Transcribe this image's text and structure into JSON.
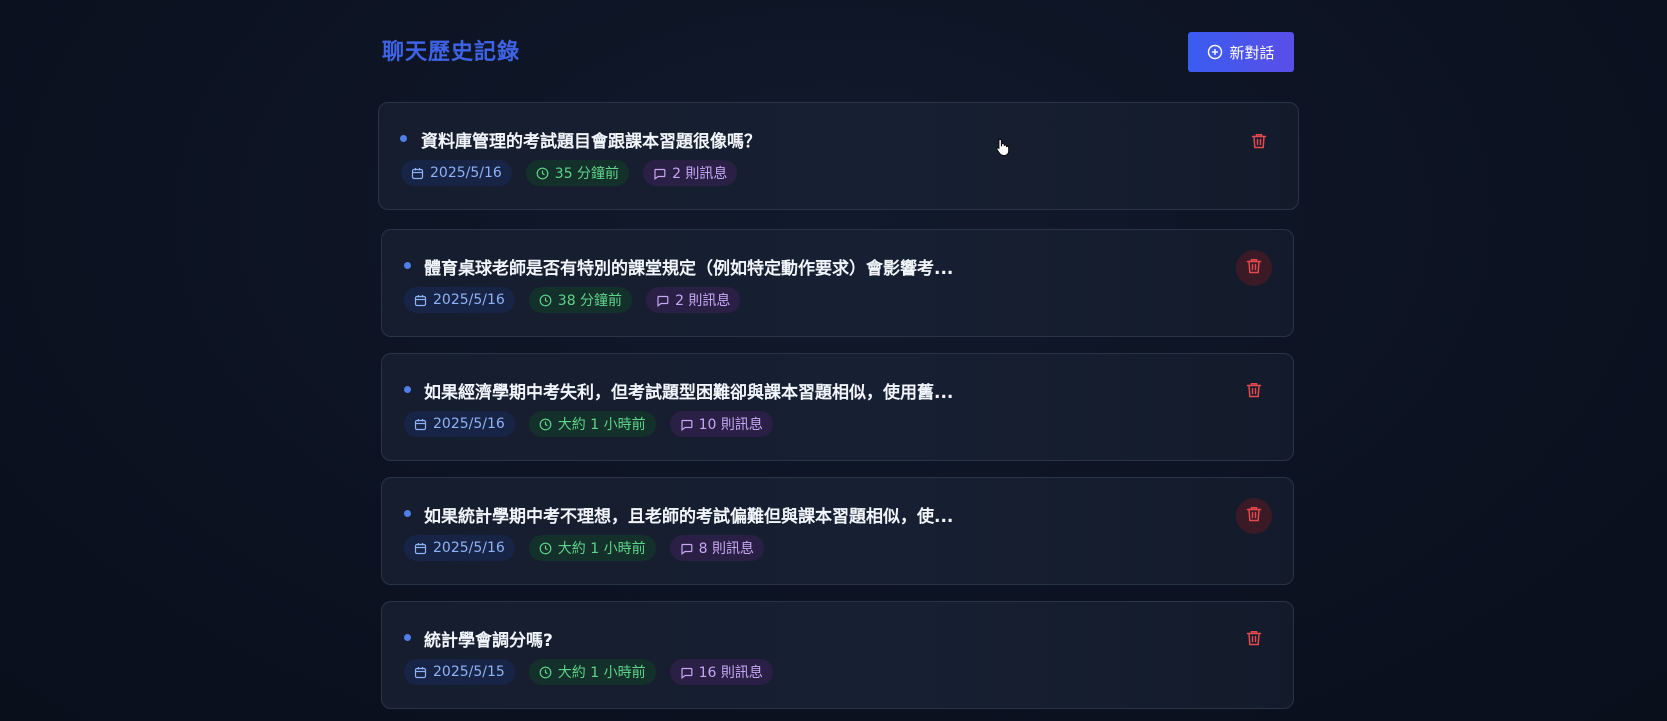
{
  "header": {
    "title": "聊天歷史記錄",
    "new_chat_label": "新對話",
    "new_chat_icon": "plus-circle-icon"
  },
  "chats": [
    {
      "title": "資料庫管理的考試題目會跟課本習題很像嗎？",
      "date": "2025/5/16",
      "time": "35 分鐘前",
      "messages": "2 則訊息"
    },
    {
      "title": "體育桌球老師是否有特別的課堂規定（例如特定動作要求）會影響考...",
      "date": "2025/5/16",
      "time": "38 分鐘前",
      "messages": "2 則訊息"
    },
    {
      "title": "如果經濟學期中考失利，但考試題型困難卻與課本習題相似，使用舊...",
      "date": "2025/5/16",
      "time": "大約 1 小時前",
      "messages": "10 則訊息"
    },
    {
      "title": "如果統計學期中考不理想，且老師的考試偏難但與課本習題相似，使...",
      "date": "2025/5/16",
      "time": "大約 1 小時前",
      "messages": "8 則訊息"
    },
    {
      "title": "統計學會調分嗎?",
      "date": "2025/5/15",
      "time": "大約 1 小時前",
      "messages": "16 則訊息"
    }
  ],
  "icons": {
    "date": "calendar-icon",
    "time": "clock-icon",
    "messages": "message-square-icon",
    "delete": "trash-icon"
  },
  "colors": {
    "accent": "#3f63e6",
    "delete": "#e5484d",
    "date_chip": "#8fb2f5",
    "time_chip": "#5fd48a",
    "messages_chip": "#c7a8f5"
  }
}
